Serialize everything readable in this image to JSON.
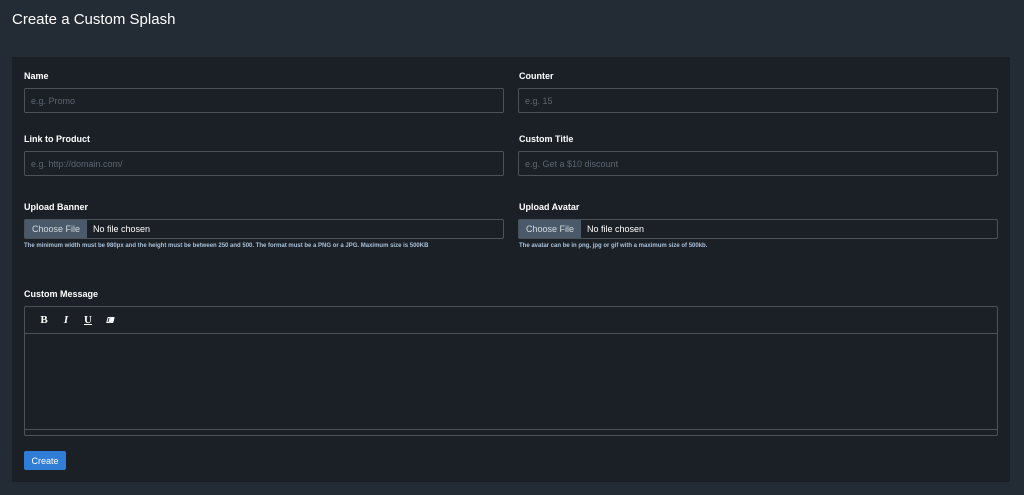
{
  "page": {
    "title": "Create a Custom Splash"
  },
  "form": {
    "name": {
      "label": "Name",
      "placeholder": "e.g. Promo"
    },
    "counter": {
      "label": "Counter",
      "placeholder": "e.g. 15"
    },
    "link": {
      "label": "Link to Product",
      "placeholder": "e.g. http://domain.com/"
    },
    "custom_title": {
      "label": "Custom Title",
      "placeholder": "e.g. Get a $10 discount"
    },
    "banner": {
      "label": "Upload Banner",
      "button": "Choose File",
      "status": "No file chosen",
      "help": "The minimum width must be 980px and the height must be between 250 and 500. The format must be a PNG or a JPG. Maximum size is 500KB"
    },
    "avatar": {
      "label": "Upload Avatar",
      "button": "Choose File",
      "status": "No file chosen",
      "help": "The avatar can be in png, jpg or gif with a maximum size of 500kb."
    },
    "message": {
      "label": "Custom Message",
      "toolbar": {
        "bold": "B",
        "italic": "I",
        "underline": "U",
        "clear_icon": "eraser-icon"
      }
    },
    "submit_label": "Create"
  },
  "colors": {
    "page_bg": "#232b35",
    "card_bg": "#1b2027",
    "input_border": "#4a525c",
    "primary_button": "#2f7dd7",
    "file_button": "#4b5a6b",
    "help_text": "#a9c1d8"
  }
}
